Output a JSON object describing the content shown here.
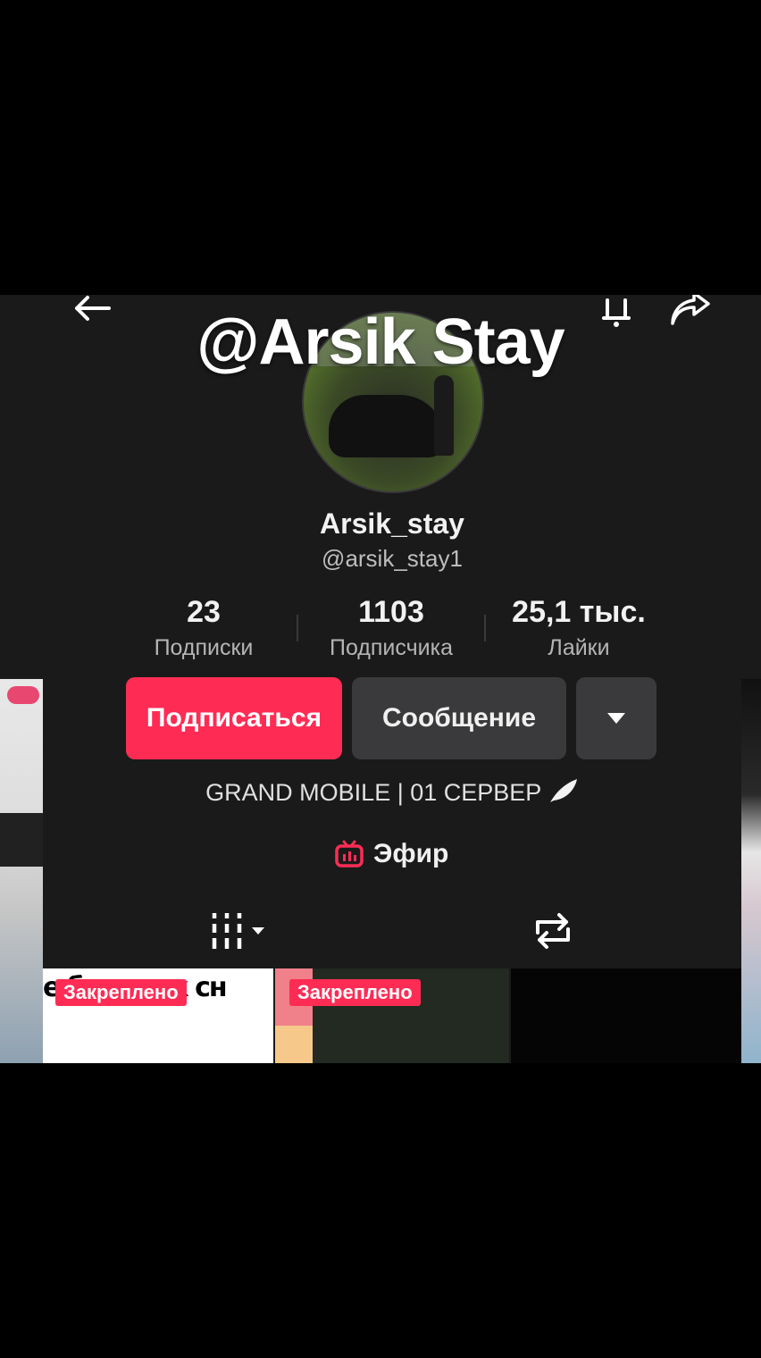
{
  "overlay": {
    "title": "@Arsik Stay"
  },
  "profile": {
    "username": "Arsik_stay",
    "handle": "@arsik_stay1",
    "bio": "GRAND MOBILE | 01 СЕРВЕР",
    "live_label": "Эфир"
  },
  "stats": [
    {
      "value": "23",
      "label": "Подписки"
    },
    {
      "value": "1103",
      "label": "Подписчика"
    },
    {
      "value": "25,1 тыс.",
      "label": "Лайки"
    }
  ],
  "actions": {
    "follow_label": "Подписаться",
    "message_label": "Сообщение"
  },
  "icons": {
    "back": "back-arrow-icon",
    "bell": "bell-icon",
    "share": "share-icon",
    "more": "chevron-down-icon",
    "live": "live-tv-icon",
    "grid": "grid-icon",
    "repost": "repost-icon",
    "feather": "feather-icon"
  },
  "videos": [
    {
      "badge": "Закреплено",
      "caption_fragment": "е бить ник сн"
    },
    {
      "badge": "Закреплено"
    },
    {}
  ],
  "colors": {
    "accent": "#fe2c55",
    "background": "#1a1a1a",
    "button_secondary": "#3a3a3c"
  }
}
